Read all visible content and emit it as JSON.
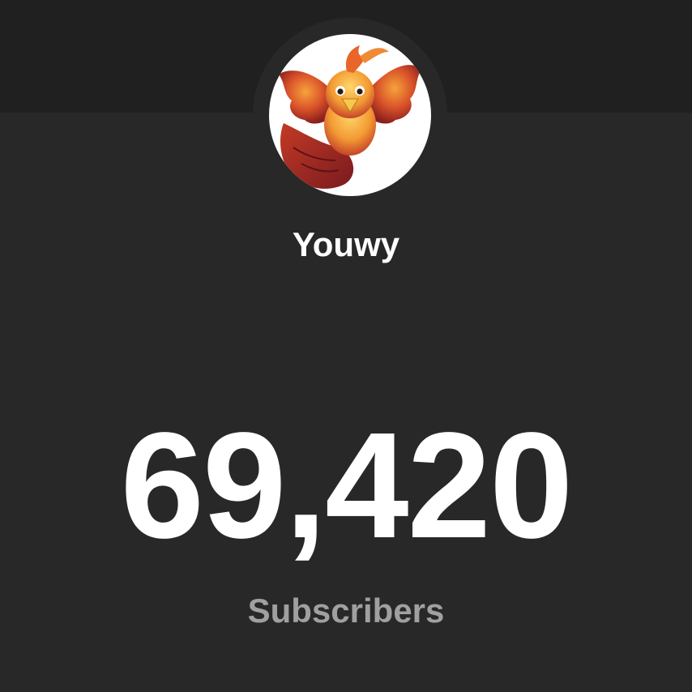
{
  "channel": {
    "name": "Youwy",
    "avatar_icon": "phoenix-bird-icon"
  },
  "stats": {
    "subscriber_count": "69,420",
    "subscriber_label": "Subscribers"
  },
  "colors": {
    "background": "#282828",
    "banner": "#202020",
    "text_primary": "#ffffff",
    "text_secondary": "#a0a0a0"
  }
}
